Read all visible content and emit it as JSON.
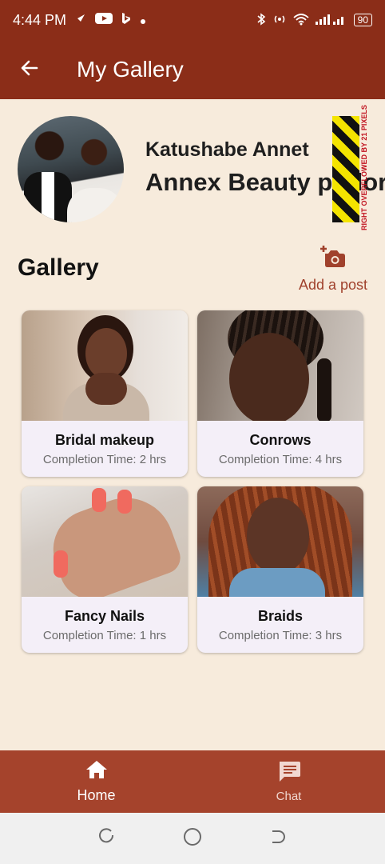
{
  "status_bar": {
    "time": "4:44 PM",
    "battery": "90",
    "icons": [
      "rocket-icon",
      "youtube-icon",
      "bing-icon",
      "dot-icon",
      "bluetooth-icon",
      "hotspot-icon",
      "wifi-icon",
      "signal-icon"
    ]
  },
  "app_bar": {
    "title": "My Gallery",
    "back_icon": "arrow-left-icon"
  },
  "profile": {
    "owner_name": "Katushabe Annet",
    "business_name": "Annex Beauty parlor"
  },
  "overflow_warning": "RIGHT OVERFLOWED BY 21 PIXELS",
  "gallery": {
    "title": "Gallery",
    "add_post_label": "Add a post",
    "add_post_icon": "add-photo-icon",
    "items": [
      {
        "title": "Bridal makeup",
        "subtitle": "Completion Time: 2 hrs"
      },
      {
        "title": "Conrows",
        "subtitle": "Completion Time: 4 hrs"
      },
      {
        "title": "Fancy Nails",
        "subtitle": "Completion Time: 1 hrs"
      },
      {
        "title": "Braids",
        "subtitle": "Completion Time: 3 hrs"
      }
    ]
  },
  "bottom_nav": {
    "items": [
      {
        "label": "Home",
        "icon": "home-icon",
        "active": true
      },
      {
        "label": "Chat",
        "icon": "chat-icon",
        "active": false
      }
    ]
  },
  "colors": {
    "header": "#8b2d18",
    "background": "#f7ebdc",
    "bottom_nav": "#a5432c",
    "accent": "#a0412c"
  }
}
